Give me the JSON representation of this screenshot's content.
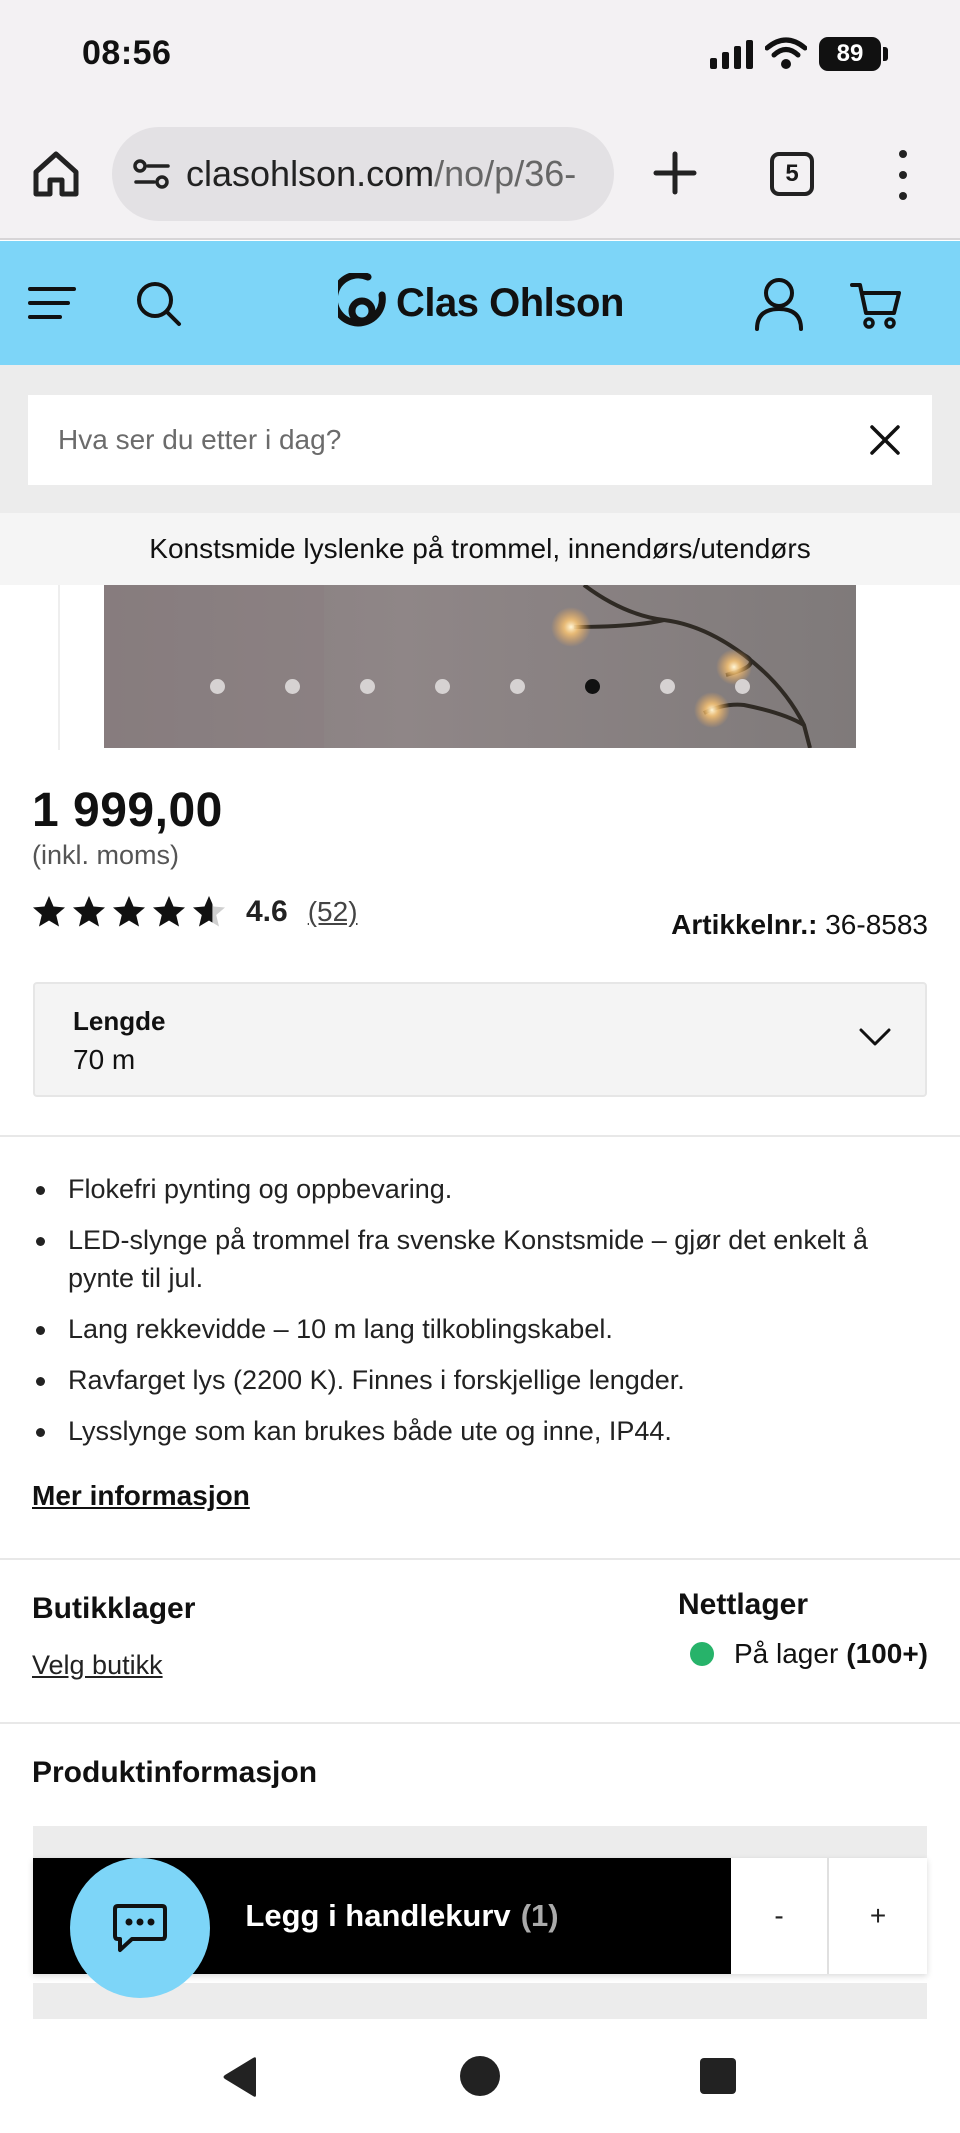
{
  "status_bar": {
    "time": "08:56",
    "battery": "89"
  },
  "browser": {
    "url_host": "clasohlson.com",
    "url_path": "/no/p/36-",
    "tab_count": "5"
  },
  "site": {
    "logo_text": "Clas Ohlson",
    "brand_color": "#7dd5f8"
  },
  "search": {
    "placeholder": "Hva ser du etter i dag?"
  },
  "product": {
    "title": "Konstsmide lyslenke på trommel, innendørs/utendørs",
    "price": "1 999,00",
    "vat_note": "(inkl. moms)",
    "rating_value": "4.6",
    "rating_stars": 4.6,
    "rating_count": "(52)",
    "article_label": "Artikkelnr.:",
    "article_number": "36-8583",
    "image_dots": {
      "total": 8,
      "active_index": 5
    },
    "length_label": "Lengde",
    "length_value": "70 m",
    "bullets": [
      "Flokefri pynting og oppbevaring.",
      "LED-slynge på trommel fra svenske Konstsmide – gjør det enkelt å pynte til jul.",
      "Lang rekkevidde – 10 m lang tilkoblingskabel.",
      "Ravfarget lys (2200 K). Finnes i forskjellige lengder.",
      "Lysslynge som kan brukes både ute og inne, IP44."
    ],
    "more_info": "Mer informasjon"
  },
  "stock": {
    "store_title": "Butikklager",
    "store_link": "Velg butikk",
    "online_title": "Nettlager",
    "online_status": "På lager",
    "online_count": "(100+)",
    "status_color": "#27b36a"
  },
  "product_info_title": "Produktinformasjon",
  "cart": {
    "add_label": "Legg i handlekurv",
    "quantity": "(1)",
    "minus": "-",
    "plus": "+"
  },
  "icons": [
    "home-icon",
    "site-settings-icon",
    "plus-icon",
    "tabs-icon",
    "more-vert-icon",
    "menu-icon",
    "search-icon",
    "clas-ohlson-logo-icon",
    "user-icon",
    "cart-icon",
    "close-icon",
    "chevron-down-icon",
    "chat-icon",
    "nav-back-icon",
    "nav-home-icon",
    "nav-recents-icon"
  ]
}
